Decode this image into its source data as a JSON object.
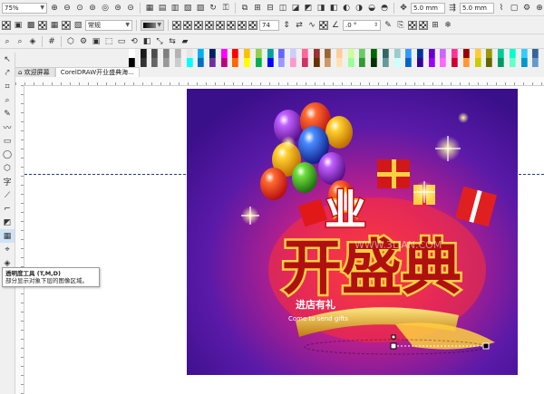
{
  "toolbar_top": {
    "zoom": "75%",
    "icons": [
      "zoom-in-icon",
      "zoom-out-icon",
      "zoom-selected-icon",
      "zoom-all-icon",
      "zoom-page-icon",
      "zoom-width-icon",
      "zoom-height-icon",
      "grid-icon",
      "align-left-icon",
      "align-center-icon",
      "align-right-icon",
      "wrap-text-icon",
      "text-rotate-icon",
      "lock-icon",
      "arrange-icon",
      "group-icon",
      "ungroup-icon",
      "combine-icon",
      "break-apart-icon",
      "weld-icon",
      "trim-icon",
      "intersect-icon",
      "simplify-icon",
      "front-minus-back-icon",
      "back-minus-front-icon",
      "boundary-icon",
      "convert-curve-icon",
      "outline-icon",
      "options-icon"
    ],
    "nudge": "5.0 mm",
    "nudge2": "5.0 mm"
  },
  "toolbar_props": {
    "transparency_type": "常规",
    "opacity": "74",
    "angle": ".0 °"
  },
  "palette": [
    "#ffffff",
    "#000000",
    "#1a1a1a",
    "#333333",
    "#4d4d4d",
    "#666666",
    "#808080",
    "#999999",
    "#b3b3b3",
    "#cccccc",
    "#e6e6e6",
    "#00ffff",
    "#00b0f0",
    "#0070c0",
    "#002060",
    "#7030a0",
    "#ff00ff",
    "#c00080",
    "#ff0000",
    "#ff6600",
    "#ffc000",
    "#ffff00",
    "#92d050",
    "#00b050",
    "#00a0a0",
    "#0000ff",
    "#6666ff",
    "#9999ff",
    "#ccccff",
    "#ff99cc",
    "#ff6699",
    "#cc3366",
    "#993333",
    "#663300",
    "#996633",
    "#cc9966",
    "#ffcc99",
    "#ffe0b3",
    "#ccff99",
    "#99ff99",
    "#66cc66",
    "#339933",
    "#006600",
    "#003300",
    "#336666",
    "#669999",
    "#99cccc",
    "#ccffff",
    "#3399ff",
    "#0066cc",
    "#003399",
    "#330099",
    "#6600cc",
    "#9900ff",
    "#cc66ff",
    "#ff66ff",
    "#ff3399",
    "#cc0033",
    "#990000",
    "#ff9933",
    "#ffcc33",
    "#cccc00",
    "#999900",
    "#666600",
    "#00cc99",
    "#009966",
    "#00ffcc",
    "#66ffcc",
    "#33ccff",
    "#0099cc",
    "#336699",
    "#6699cc"
  ],
  "tabs": [
    "欢迎屏幕",
    "CorelDRAW开业盛典海..."
  ],
  "toolbox": [
    "pick-tool-icon",
    "shape-tool-icon",
    "crop-tool-icon",
    "zoom-tool-icon",
    "freehand-tool-icon",
    "artistic-media-icon",
    "rectangle-tool-icon",
    "ellipse-tool-icon",
    "polygon-tool-icon",
    "text-tool-icon",
    "parallel-dimension-icon",
    "connector-tool-icon",
    "drop-shadow-tool-icon",
    "transparency-tool-icon",
    "eyedropper-tool-icon",
    "interactive-fill-icon",
    "smart-fill-icon"
  ],
  "tooltip": {
    "title": "透明度工具 (T,M,D)",
    "desc": "部分显示对象下层的图像区域。"
  },
  "poster": {
    "main": "开盛典",
    "sub": "进店有礼",
    "en": "Come to send gifts",
    "watermark": "WWW.3LIAN.COM"
  }
}
